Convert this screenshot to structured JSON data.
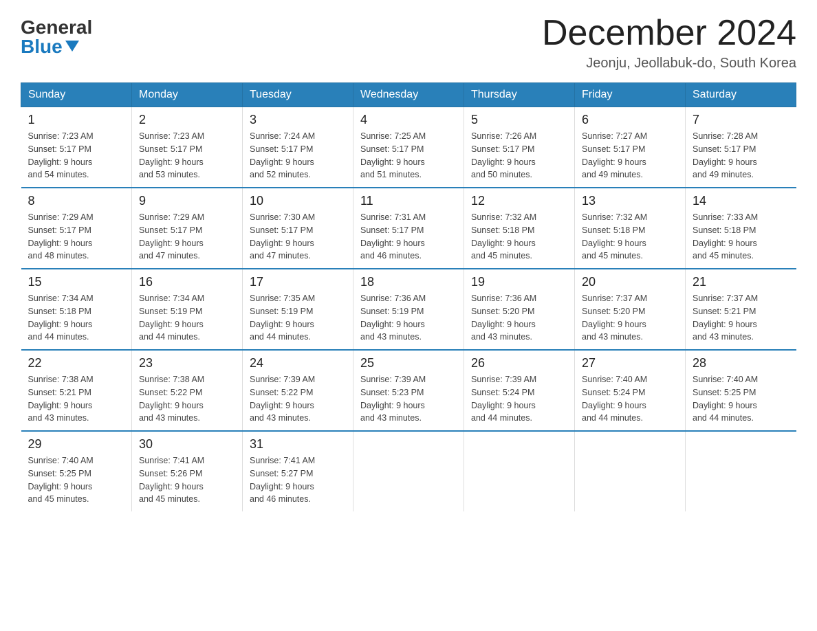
{
  "logo": {
    "general": "General",
    "blue": "Blue"
  },
  "title": "December 2024",
  "location": "Jeonju, Jeollabuk-do, South Korea",
  "days_of_week": [
    "Sunday",
    "Monday",
    "Tuesday",
    "Wednesday",
    "Thursday",
    "Friday",
    "Saturday"
  ],
  "weeks": [
    [
      {
        "day": "1",
        "sunrise": "7:23 AM",
        "sunset": "5:17 PM",
        "daylight": "9 hours and 54 minutes."
      },
      {
        "day": "2",
        "sunrise": "7:23 AM",
        "sunset": "5:17 PM",
        "daylight": "9 hours and 53 minutes."
      },
      {
        "day": "3",
        "sunrise": "7:24 AM",
        "sunset": "5:17 PM",
        "daylight": "9 hours and 52 minutes."
      },
      {
        "day": "4",
        "sunrise": "7:25 AM",
        "sunset": "5:17 PM",
        "daylight": "9 hours and 51 minutes."
      },
      {
        "day": "5",
        "sunrise": "7:26 AM",
        "sunset": "5:17 PM",
        "daylight": "9 hours and 50 minutes."
      },
      {
        "day": "6",
        "sunrise": "7:27 AM",
        "sunset": "5:17 PM",
        "daylight": "9 hours and 49 minutes."
      },
      {
        "day": "7",
        "sunrise": "7:28 AM",
        "sunset": "5:17 PM",
        "daylight": "9 hours and 49 minutes."
      }
    ],
    [
      {
        "day": "8",
        "sunrise": "7:29 AM",
        "sunset": "5:17 PM",
        "daylight": "9 hours and 48 minutes."
      },
      {
        "day": "9",
        "sunrise": "7:29 AM",
        "sunset": "5:17 PM",
        "daylight": "9 hours and 47 minutes."
      },
      {
        "day": "10",
        "sunrise": "7:30 AM",
        "sunset": "5:17 PM",
        "daylight": "9 hours and 47 minutes."
      },
      {
        "day": "11",
        "sunrise": "7:31 AM",
        "sunset": "5:17 PM",
        "daylight": "9 hours and 46 minutes."
      },
      {
        "day": "12",
        "sunrise": "7:32 AM",
        "sunset": "5:18 PM",
        "daylight": "9 hours and 45 minutes."
      },
      {
        "day": "13",
        "sunrise": "7:32 AM",
        "sunset": "5:18 PM",
        "daylight": "9 hours and 45 minutes."
      },
      {
        "day": "14",
        "sunrise": "7:33 AM",
        "sunset": "5:18 PM",
        "daylight": "9 hours and 45 minutes."
      }
    ],
    [
      {
        "day": "15",
        "sunrise": "7:34 AM",
        "sunset": "5:18 PM",
        "daylight": "9 hours and 44 minutes."
      },
      {
        "day": "16",
        "sunrise": "7:34 AM",
        "sunset": "5:19 PM",
        "daylight": "9 hours and 44 minutes."
      },
      {
        "day": "17",
        "sunrise": "7:35 AM",
        "sunset": "5:19 PM",
        "daylight": "9 hours and 44 minutes."
      },
      {
        "day": "18",
        "sunrise": "7:36 AM",
        "sunset": "5:19 PM",
        "daylight": "9 hours and 43 minutes."
      },
      {
        "day": "19",
        "sunrise": "7:36 AM",
        "sunset": "5:20 PM",
        "daylight": "9 hours and 43 minutes."
      },
      {
        "day": "20",
        "sunrise": "7:37 AM",
        "sunset": "5:20 PM",
        "daylight": "9 hours and 43 minutes."
      },
      {
        "day": "21",
        "sunrise": "7:37 AM",
        "sunset": "5:21 PM",
        "daylight": "9 hours and 43 minutes."
      }
    ],
    [
      {
        "day": "22",
        "sunrise": "7:38 AM",
        "sunset": "5:21 PM",
        "daylight": "9 hours and 43 minutes."
      },
      {
        "day": "23",
        "sunrise": "7:38 AM",
        "sunset": "5:22 PM",
        "daylight": "9 hours and 43 minutes."
      },
      {
        "day": "24",
        "sunrise": "7:39 AM",
        "sunset": "5:22 PM",
        "daylight": "9 hours and 43 minutes."
      },
      {
        "day": "25",
        "sunrise": "7:39 AM",
        "sunset": "5:23 PM",
        "daylight": "9 hours and 43 minutes."
      },
      {
        "day": "26",
        "sunrise": "7:39 AM",
        "sunset": "5:24 PM",
        "daylight": "9 hours and 44 minutes."
      },
      {
        "day": "27",
        "sunrise": "7:40 AM",
        "sunset": "5:24 PM",
        "daylight": "9 hours and 44 minutes."
      },
      {
        "day": "28",
        "sunrise": "7:40 AM",
        "sunset": "5:25 PM",
        "daylight": "9 hours and 44 minutes."
      }
    ],
    [
      {
        "day": "29",
        "sunrise": "7:40 AM",
        "sunset": "5:25 PM",
        "daylight": "9 hours and 45 minutes."
      },
      {
        "day": "30",
        "sunrise": "7:41 AM",
        "sunset": "5:26 PM",
        "daylight": "9 hours and 45 minutes."
      },
      {
        "day": "31",
        "sunrise": "7:41 AM",
        "sunset": "5:27 PM",
        "daylight": "9 hours and 46 minutes."
      },
      {
        "day": "",
        "sunrise": "",
        "sunset": "",
        "daylight": ""
      },
      {
        "day": "",
        "sunrise": "",
        "sunset": "",
        "daylight": ""
      },
      {
        "day": "",
        "sunrise": "",
        "sunset": "",
        "daylight": ""
      },
      {
        "day": "",
        "sunrise": "",
        "sunset": "",
        "daylight": ""
      }
    ]
  ],
  "labels": {
    "sunrise": "Sunrise:",
    "sunset": "Sunset:",
    "daylight": "Daylight:"
  },
  "accent_color": "#2980b9"
}
